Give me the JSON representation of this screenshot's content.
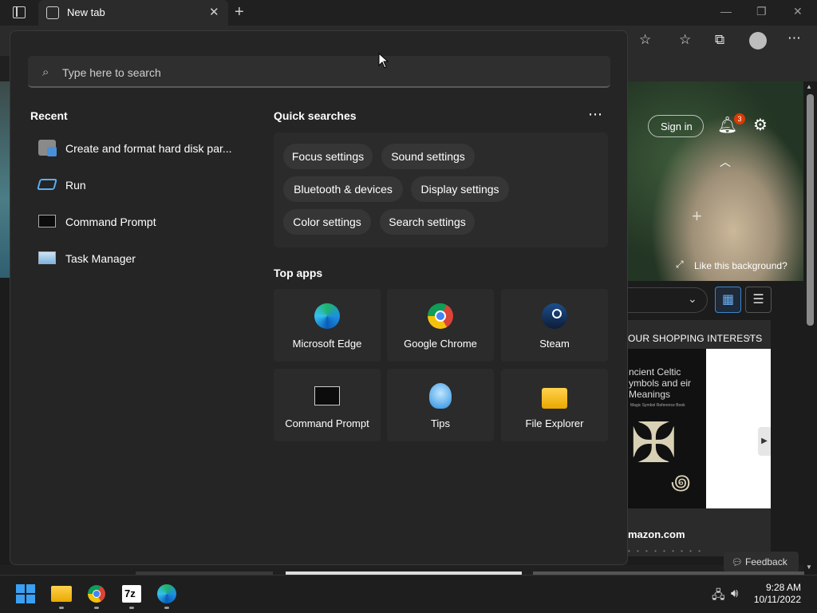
{
  "browser": {
    "tab_title": "New tab",
    "sign_in": "Sign in",
    "notification_count": "3",
    "like_background": "Like this background?",
    "card_header": "OUR SHOPPING INTERESTS",
    "book_title": "ncient Celtic ymbols and eir Meanings",
    "book_sub": "Magic Symbol Reference Book",
    "amazon": "mazon.com",
    "feedback": "Feedback"
  },
  "start_menu": {
    "search_placeholder": "Type here to search",
    "recent_title": "Recent",
    "recent": [
      {
        "label": "Create and format hard disk par...",
        "icon": "disk-management-icon"
      },
      {
        "label": "Run",
        "icon": "run-icon"
      },
      {
        "label": "Command Prompt",
        "icon": "command-prompt-icon"
      },
      {
        "label": "Task Manager",
        "icon": "task-manager-icon"
      }
    ],
    "quick_searches_title": "Quick searches",
    "quick_searches": [
      "Focus settings",
      "Sound settings",
      "Bluetooth & devices",
      "Display settings",
      "Color settings",
      "Search settings"
    ],
    "top_apps_title": "Top apps",
    "top_apps": [
      {
        "label": "Microsoft Edge",
        "icon": "edge-icon"
      },
      {
        "label": "Google Chrome",
        "icon": "chrome-icon"
      },
      {
        "label": "Steam",
        "icon": "steam-icon"
      },
      {
        "label": "Command Prompt",
        "icon": "command-prompt-icon"
      },
      {
        "label": "Tips",
        "icon": "tips-icon"
      },
      {
        "label": "File Explorer",
        "icon": "file-explorer-icon"
      }
    ]
  },
  "taskbar": {
    "time": "9:28 AM",
    "date": "10/11/2022",
    "apps": [
      "windows-start-icon",
      "file-explorer-icon",
      "chrome-icon",
      "7zip-icon",
      "edge-icon"
    ],
    "sevenzip_label": "7z"
  },
  "colors": {
    "accent": "#3a86d1",
    "badge": "#d83b01",
    "menu_bg": "#252525"
  }
}
